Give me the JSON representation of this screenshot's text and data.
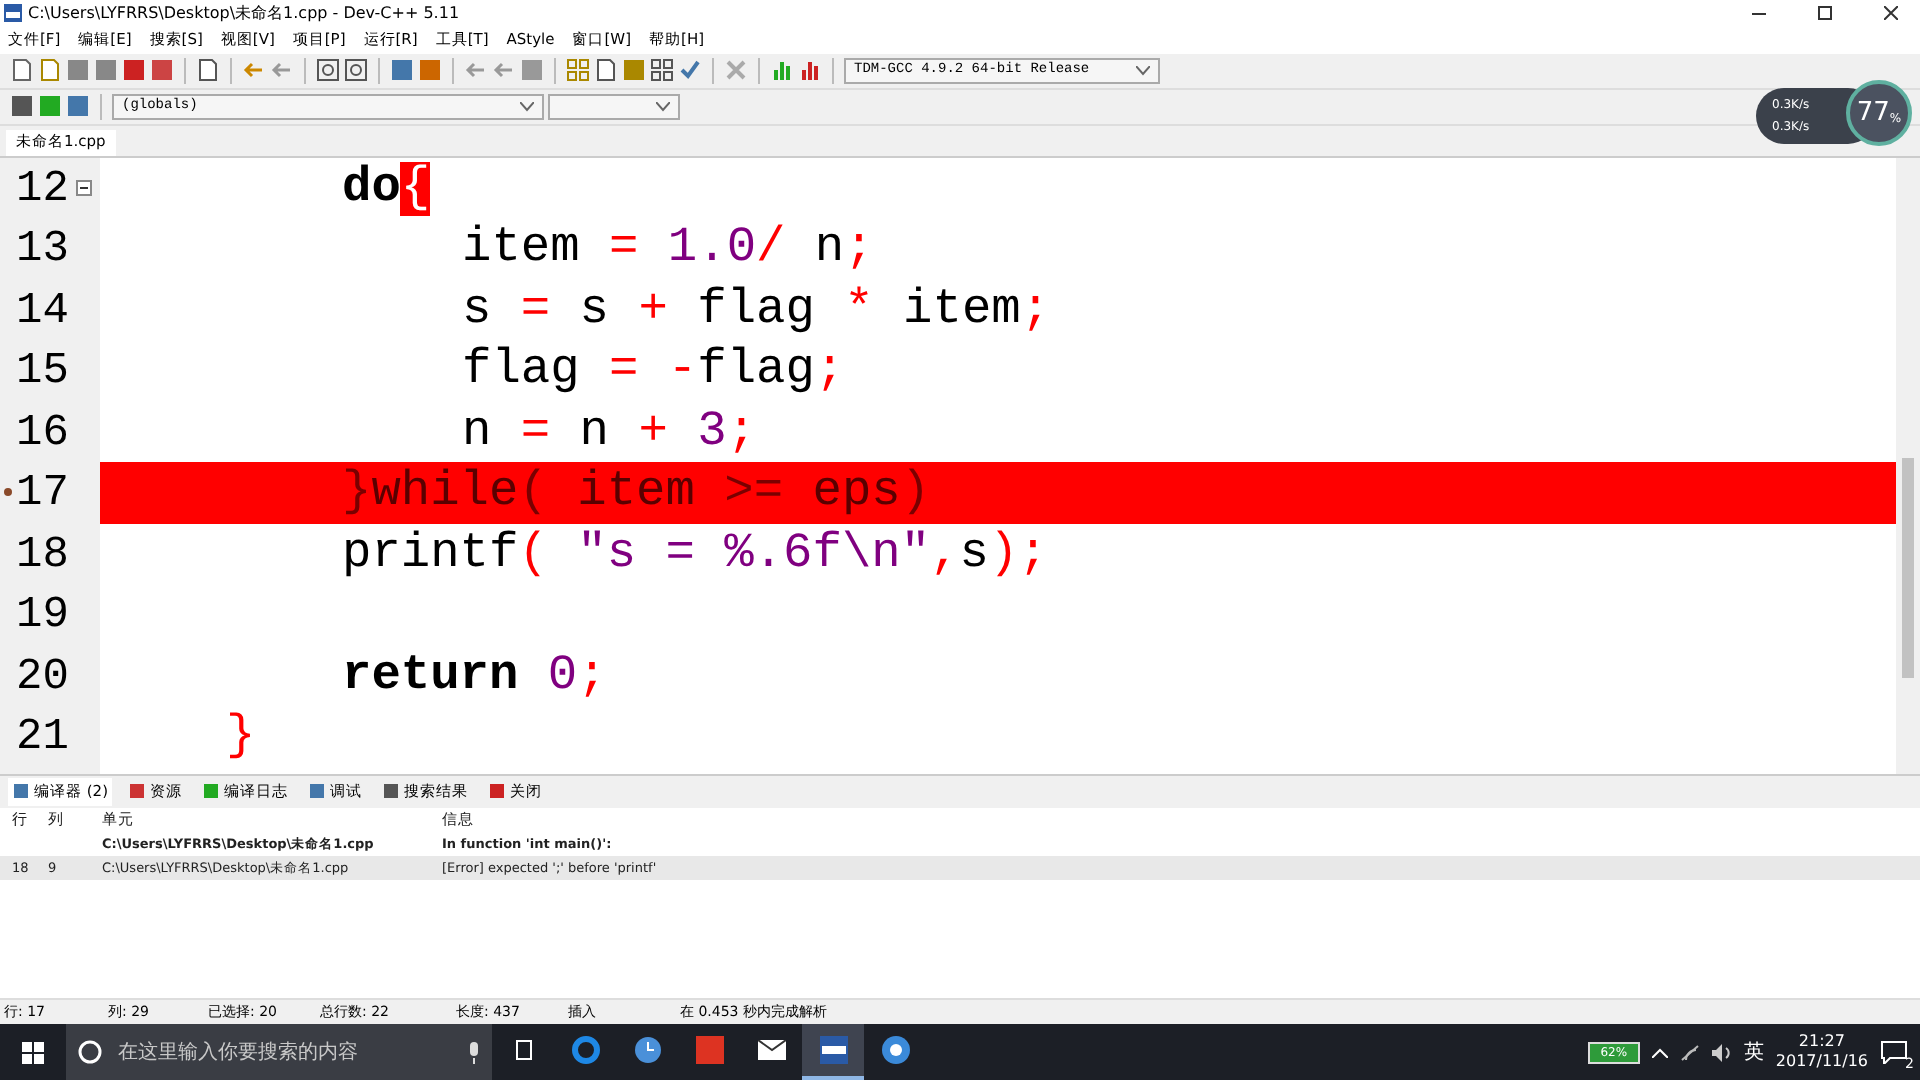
{
  "window": {
    "title": "C:\\Users\\LYFRRS\\Desktop\\未命名1.cpp - Dev-C++ 5.11"
  },
  "menu": [
    "文件[F]",
    "编辑[E]",
    "搜索[S]",
    "视图[V]",
    "项目[P]",
    "运行[R]",
    "工具[T]",
    "AStyle",
    "窗口[W]",
    "帮助[H]"
  ],
  "compiler_select": {
    "value": "TDM-GCC 4.9.2 64-bit Release"
  },
  "scope_select": {
    "value": "(globals)"
  },
  "file_tabs": [
    {
      "label": "未命名1.cpp",
      "selected": true
    }
  ],
  "editor": {
    "lines": [
      {
        "number": "12",
        "kind": "body",
        "fold": true,
        "error": false,
        "tokens": [
          {
            "kind": "kw",
            "text": "do"
          },
          {
            "kind": "match",
            "text": "{"
          }
        ]
      },
      {
        "number": "13",
        "kind": "inner",
        "fold": false,
        "error": false,
        "tokens": [
          {
            "kind": "id",
            "text": "item "
          },
          {
            "kind": "op",
            "text": "="
          },
          {
            "kind": "num",
            "text": " 1.0"
          },
          {
            "kind": "op",
            "text": "/"
          },
          {
            "kind": "id",
            "text": " n"
          },
          {
            "kind": "op",
            "text": ";"
          }
        ]
      },
      {
        "number": "14",
        "kind": "inner",
        "fold": false,
        "error": false,
        "tokens": [
          {
            "kind": "id",
            "text": "s "
          },
          {
            "kind": "op",
            "text": "="
          },
          {
            "kind": "id",
            "text": " s "
          },
          {
            "kind": "op",
            "text": "+"
          },
          {
            "kind": "id",
            "text": " flag "
          },
          {
            "kind": "op",
            "text": "*"
          },
          {
            "kind": "id",
            "text": " item"
          },
          {
            "kind": "op",
            "text": ";"
          }
        ]
      },
      {
        "number": "15",
        "kind": "inner",
        "fold": false,
        "error": false,
        "tokens": [
          {
            "kind": "id",
            "text": "flag "
          },
          {
            "kind": "op",
            "text": "= -"
          },
          {
            "kind": "id",
            "text": "flag"
          },
          {
            "kind": "op",
            "text": ";"
          }
        ]
      },
      {
        "number": "16",
        "kind": "inner",
        "fold": false,
        "error": false,
        "tokens": [
          {
            "kind": "id",
            "text": "n "
          },
          {
            "kind": "op",
            "text": "="
          },
          {
            "kind": "id",
            "text": " n "
          },
          {
            "kind": "op",
            "text": "+"
          },
          {
            "kind": "num",
            "text": " 3"
          },
          {
            "kind": "op",
            "text": ";"
          }
        ]
      },
      {
        "number": "17",
        "kind": "body",
        "fold": false,
        "error": true,
        "tokens": [
          {
            "kind": "op",
            "text": "}"
          },
          {
            "kind": "kw",
            "text": "while"
          },
          {
            "kind": "op",
            "text": "("
          },
          {
            "kind": "id",
            "text": " item "
          },
          {
            "kind": "op",
            "text": ">="
          },
          {
            "kind": "id",
            "text": " eps"
          },
          {
            "kind": "op",
            "text": ")"
          }
        ]
      },
      {
        "number": "18",
        "kind": "body",
        "fold": false,
        "error": false,
        "tokens": [
          {
            "kind": "id",
            "text": "printf"
          },
          {
            "kind": "op",
            "text": "("
          },
          {
            "kind": "str",
            "text": " \"s = %.6f\\n\""
          },
          {
            "kind": "op",
            "text": ","
          },
          {
            "kind": "id",
            "text": "s"
          },
          {
            "kind": "op",
            "text": ");"
          }
        ]
      },
      {
        "number": "19",
        "kind": "body",
        "fold": false,
        "error": false
      },
      {
        "number": "20",
        "kind": "body",
        "fold": false,
        "error": false,
        "tokens": [
          {
            "kind": "kw",
            "text": "return"
          },
          {
            "kind": "num",
            "text": " 0"
          },
          {
            "kind": "op",
            "text": ";"
          }
        ]
      },
      {
        "number": "21",
        "kind": "top",
        "fold": false,
        "error": false,
        "tokens": [
          {
            "kind": "op",
            "text": "}"
          }
        ]
      }
    ]
  },
  "panel_tabs": [
    {
      "label": "编译器 (2)",
      "selected": true
    },
    {
      "label": "资源",
      "selected": false
    },
    {
      "label": "编译日志",
      "selected": false
    },
    {
      "label": "调试",
      "selected": false
    },
    {
      "label": "搜索结果",
      "selected": false
    },
    {
      "label": "关闭",
      "selected": false
    }
  ],
  "messages": {
    "columns": [
      "行",
      "列",
      "单元",
      "信息"
    ],
    "rows": [
      {
        "selected": false,
        "bold": true,
        "cells": [
          "",
          "",
          "C:\\Users\\LYFRRS\\Desktop\\未命名1.cpp",
          "In function 'int main()':"
        ]
      },
      {
        "selected": true,
        "bold": false,
        "cells": [
          "18",
          "9",
          "C:\\Users\\LYFRRS\\Desktop\\未命名1.cpp",
          "[Error] expected ';' before 'printf'"
        ]
      }
    ]
  },
  "status_bar": [
    {
      "label": "行:",
      "value": "17"
    },
    {
      "label": "列:",
      "value": "29"
    },
    {
      "label": "已选择:",
      "value": "20"
    },
    {
      "label": "总行数:",
      "value": "22"
    },
    {
      "label": "长度:",
      "value": "437"
    },
    {
      "label": "插入"
    },
    {
      "label": "在 0.453 秒内完成解析"
    }
  ],
  "network_widget": {
    "upload": "0.3K/s",
    "download": "0.3K/s",
    "percent": "77",
    "unit": "%"
  },
  "taskbar": {
    "search": {
      "placeholder": "在这里输入你要搜索的内容"
    },
    "apps": [
      {
        "kind": "edge",
        "selected": false
      },
      {
        "kind": "clock",
        "selected": false
      },
      {
        "kind": "red",
        "selected": false
      },
      {
        "kind": "mail",
        "selected": false
      },
      {
        "kind": "devcpp",
        "selected": true
      },
      {
        "kind": "sogou",
        "selected": false
      }
    ],
    "battery": "62%",
    "ime": "英",
    "time": "21:27",
    "date": "2017/11/16",
    "notifications": "2"
  }
}
